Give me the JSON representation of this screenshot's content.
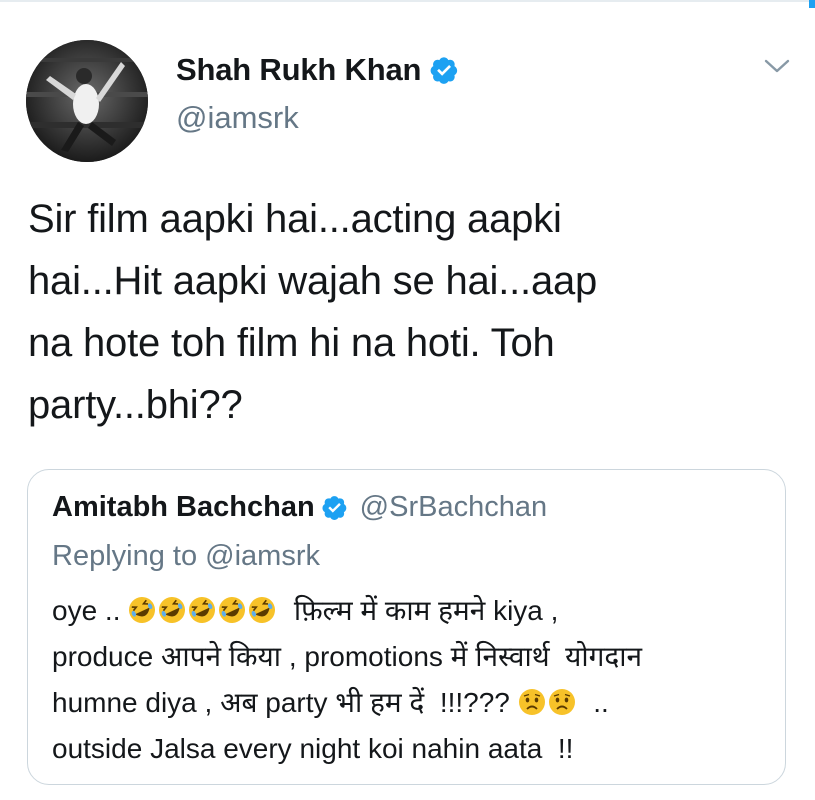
{
  "author": {
    "name": "Shah Rukh Khan",
    "handle": "@iamsrk",
    "verified": true
  },
  "tweet": {
    "lines": [
      "Sir film aapki hai...acting aapki",
      "hai...Hit aapki wajah se hai...aap",
      "na hote toh film hi na hoti. Toh",
      "party...bhi??"
    ]
  },
  "quoted": {
    "name": "Amitabh Bachchan",
    "handle": "@SrBachchan",
    "verified": true,
    "replying_prefix": "Replying to",
    "replying_to": "@iamsrk",
    "line1_start": "oye .. ",
    "line1_emoji_count": 5,
    "line1_end": "  फ़िल्म में काम हमने kiya ,",
    "line2": "produce आपने किया , promotions में निस्वार्थ  योगदान",
    "line3_start": "humne diya , अब party भी हम दें  !!!??? ",
    "line3_end": "  ..",
    "line4": "outside Jalsa every night koi nahin aata  !!"
  },
  "icons": {
    "verified": "verified-badge-icon",
    "menu": "chevron-down-icon",
    "laugh": "rolling-on-floor-laughing-emoji",
    "worried": "worried-face-emoji"
  },
  "colors": {
    "accent": "#1da1f2",
    "secondary_text": "#657786",
    "border": "#ccd6dd"
  }
}
